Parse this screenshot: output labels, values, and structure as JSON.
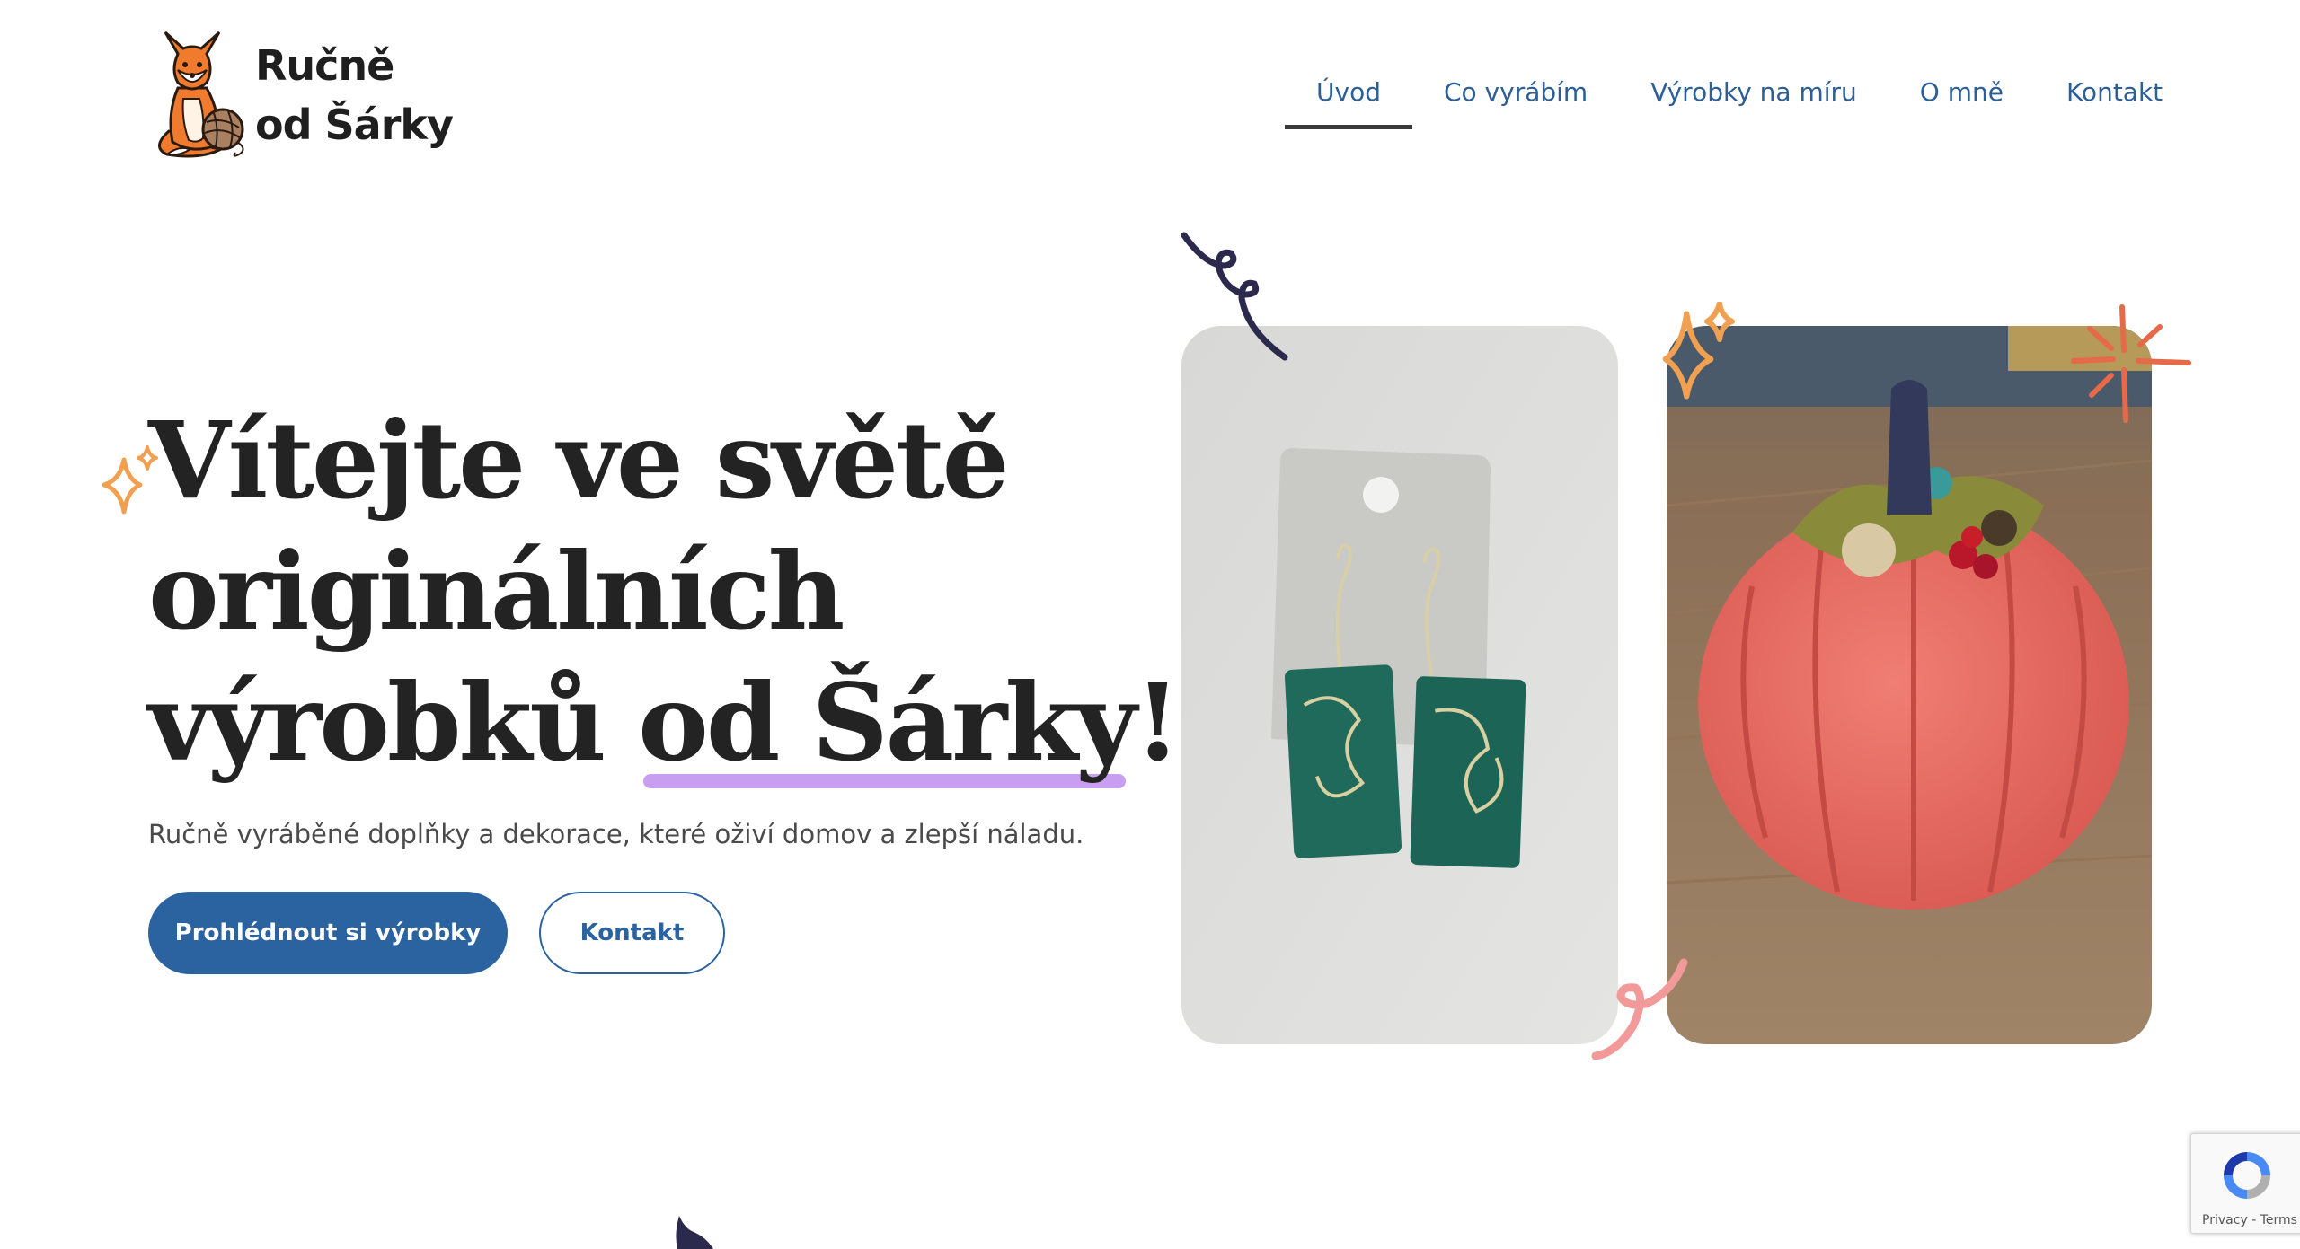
{
  "header": {
    "logo": {
      "line1": "Ručně",
      "line2": "od Šárky"
    },
    "nav": [
      {
        "label": "Úvod",
        "active": true
      },
      {
        "label": "Co vyrábím",
        "active": false
      },
      {
        "label": "Výrobky na míru",
        "active": false
      },
      {
        "label": "O mně",
        "active": false
      },
      {
        "label": "Kontakt",
        "active": false
      }
    ]
  },
  "hero": {
    "title_line1": "Vítejte ve světě",
    "title_line2": "originálních",
    "title_line3_start": "výrobků ",
    "title_highlight": "od Šárky",
    "title_end": "!",
    "subtitle": "Ručně vyráběné doplňky a dekorace, které oživí domov a zlepší náladu.",
    "primary_button": "Prohlédnout si výrobky",
    "secondary_button": "Kontakt"
  },
  "photos": [
    {
      "subject": "green polymer clay earrings on a card"
    },
    {
      "subject": "crocheted coral pumpkin"
    }
  ],
  "recaptcha": {
    "privacy": "Privacy",
    "separator": " - ",
    "terms": "Terms"
  },
  "colors": {
    "primary": "#2b62a0",
    "nav_text": "#2d5f97",
    "highlight_underline": "#c89ef0",
    "heading": "#232323",
    "sparkle_orange": "#f0a050",
    "squiggle_navy": "#2b2a4c",
    "squiggle_pink": "#f29a9a",
    "burst_red": "#e56a4a"
  }
}
